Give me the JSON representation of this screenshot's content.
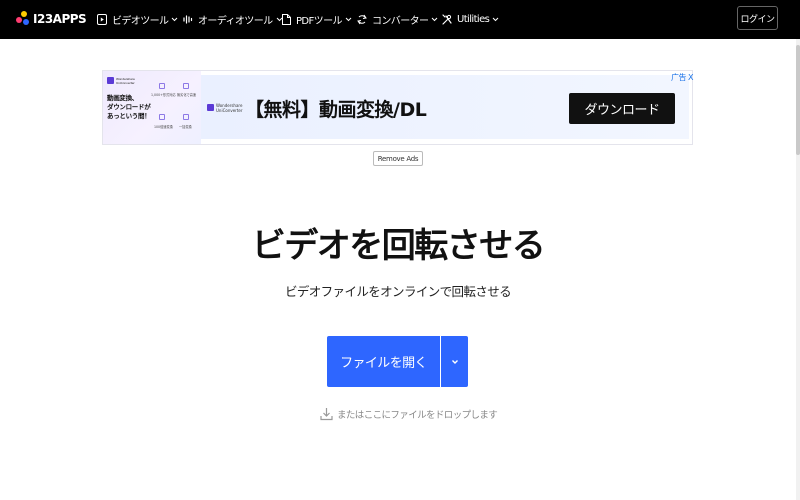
{
  "logo": {
    "text": "I23APPS"
  },
  "nav": {
    "items": [
      {
        "label": "ビデオツール",
        "icon": "video-play-icon"
      },
      {
        "label": "オーディオツール",
        "icon": "audio-wave-icon"
      },
      {
        "label": "PDFツール",
        "icon": "document-icon"
      },
      {
        "label": "コンバーター",
        "icon": "convert-icon"
      },
      {
        "label": "Utilities",
        "icon": "tools-icon"
      }
    ],
    "login_label": "ログイン"
  },
  "ad": {
    "brand_line1": "Wondershare",
    "brand_line2": "UniConverter",
    "left_headline_line1": "動画変換、",
    "left_headline_line2": "ダウンロードが",
    "left_headline_line3": "あっという間！",
    "features": [
      "1,000+形式対応",
      "無劣化で高速",
      "100倍速変換",
      "一括変換"
    ],
    "headline": "【無料】動画変換/DL",
    "cta_label": "ダウンロード",
    "choices_label": "广告",
    "close_label": "X",
    "remove_ads_label": "Remove Ads"
  },
  "main": {
    "title": "ビデオを回転させる",
    "subtitle": "ビデオファイルをオンラインで回転させる",
    "open_button_label": "ファイルを開く",
    "drop_hint": "またはここにファイルをドロップします"
  },
  "colors": {
    "topbar": "#000000",
    "primary_button": "#2e66ff",
    "ad_cta": "#111111",
    "ad_choices": "#1a73e8"
  }
}
